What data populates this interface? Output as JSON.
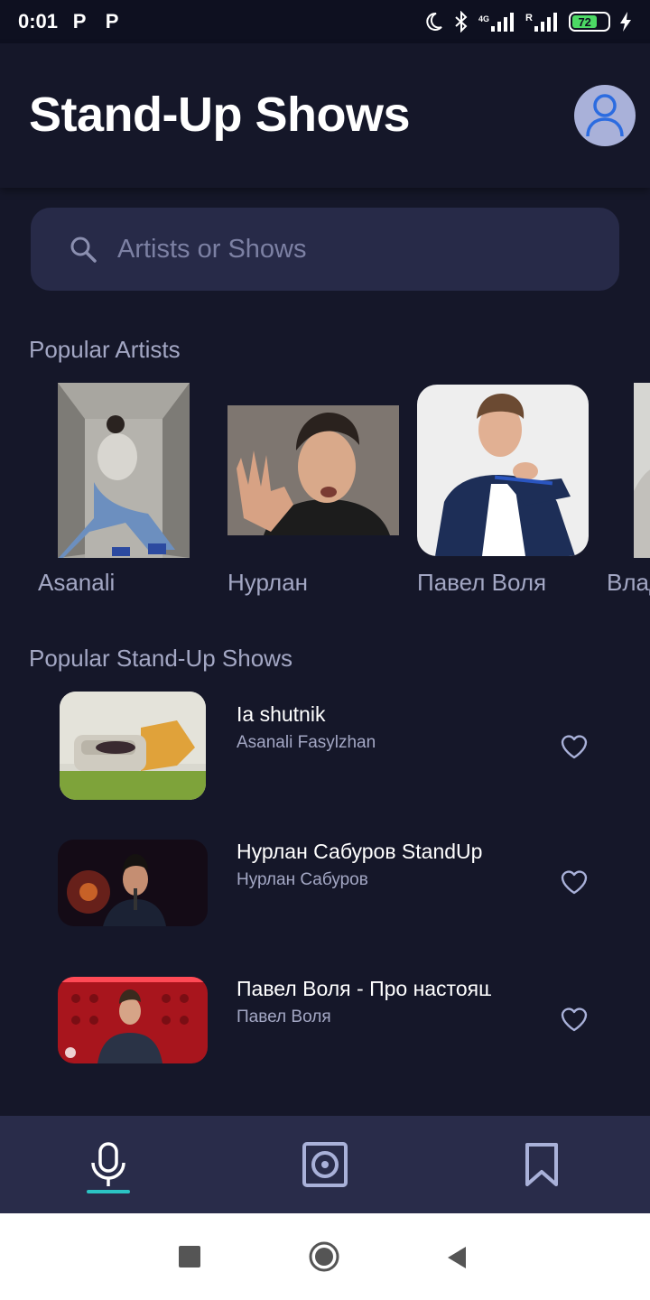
{
  "status_bar": {
    "time": "0:01",
    "notif_icons": [
      "P",
      "P"
    ],
    "network_label": "4G",
    "roaming_label": "R",
    "battery": "72"
  },
  "header": {
    "title": "Stand-Up Shows",
    "avatar_icon": "person-icon"
  },
  "search": {
    "placeholder": "Artists or Shows",
    "icon": "search-icon"
  },
  "popular_artists": {
    "title": "Popular Artists",
    "items": [
      {
        "name": "Asanali"
      },
      {
        "name": "Нурлан"
      },
      {
        "name": "Павел Воля"
      },
      {
        "name": "Влад"
      }
    ]
  },
  "popular_shows": {
    "title": "Popular Stand-Up Shows",
    "items": [
      {
        "title": "Ia shutnik",
        "artist": "Asanali Fasylzhan",
        "icon": "heart-outline-icon"
      },
      {
        "title": "Нурлан Сабуров StandUp",
        "artist": "Нурлан Сабуров",
        "icon": "heart-outline-icon"
      },
      {
        "title": "Павел Воля - Про настоящее",
        "artist": "Павел Воля",
        "icon": "heart-outline-icon"
      }
    ]
  },
  "bottom_nav": {
    "items": [
      {
        "icon": "microphone-icon",
        "active": true
      },
      {
        "icon": "speaker-icon",
        "active": false
      },
      {
        "icon": "bookmark-icon",
        "active": false
      }
    ],
    "accent": "#2bc4c4"
  },
  "system_nav": [
    "recents-icon",
    "home-icon",
    "back-icon"
  ],
  "colors": {
    "background": "#151729",
    "surface": "#272a48",
    "nav": "#292c4a",
    "muted_text": "#a3a7c4",
    "avatar": "#a9b1d9",
    "accent": "#2bc4c4"
  }
}
